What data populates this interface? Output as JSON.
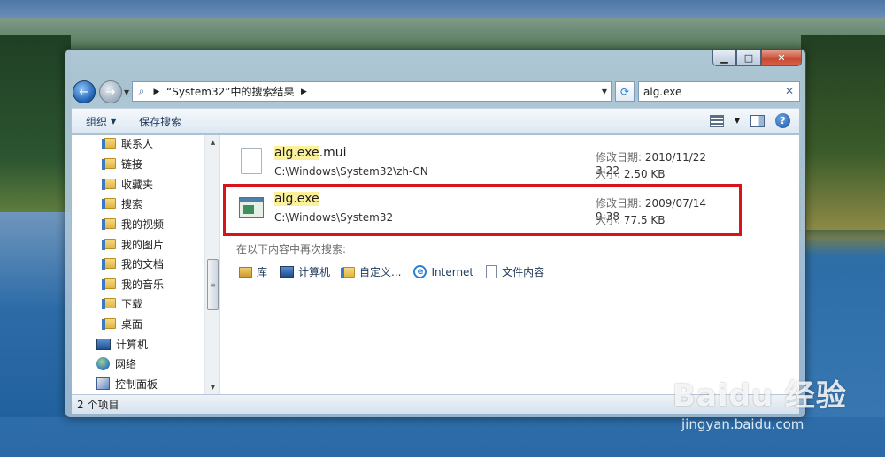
{
  "window": {
    "caption_buttons": {
      "minimize": "▁",
      "maximize": "□",
      "close": "✕"
    }
  },
  "address": {
    "breadcrumb": "“System32”中的搜索结果",
    "back_glyph": "←",
    "forward_glyph": "→"
  },
  "search": {
    "value": "alg.exe",
    "clear_glyph": "✕"
  },
  "toolbar": {
    "organize_label": "组织",
    "save_search_label": "保存搜索",
    "help_glyph": "?"
  },
  "nav_pane": {
    "items": [
      {
        "label": "联系人",
        "icon": "folder-icon"
      },
      {
        "label": "链接",
        "icon": "folder-icon"
      },
      {
        "label": "收藏夹",
        "icon": "folder-icon"
      },
      {
        "label": "搜索",
        "icon": "folder-icon"
      },
      {
        "label": "我的视频",
        "icon": "folder-icon"
      },
      {
        "label": "我的图片",
        "icon": "folder-icon"
      },
      {
        "label": "我的文档",
        "icon": "folder-icon"
      },
      {
        "label": "我的音乐",
        "icon": "folder-icon"
      },
      {
        "label": "下载",
        "icon": "folder-icon"
      },
      {
        "label": "桌面",
        "icon": "folder-icon"
      },
      {
        "label": "计算机",
        "icon": "computer-icon"
      },
      {
        "label": "网络",
        "icon": "network-icon"
      },
      {
        "label": "控制面板",
        "icon": "control-panel-icon"
      }
    ]
  },
  "results": [
    {
      "name_highlight": "alg.exe",
      "name_rest": ".mui",
      "path": "C:\\Windows\\System32\\zh-CN",
      "modified_label": "修改日期:",
      "modified_value": "2010/11/22 3:22",
      "size_label": "大小:",
      "size_value": "2.50 KB",
      "icon": "file-icon"
    },
    {
      "name_highlight": "alg.exe",
      "name_rest": "",
      "path": "C:\\Windows\\System32",
      "modified_label": "修改日期:",
      "modified_value": "2009/07/14 9:38",
      "size_label": "大小:",
      "size_value": "77.5 KB",
      "icon": "exe-icon"
    }
  ],
  "search_again": {
    "heading": "在以下内容中再次搜索:",
    "options": [
      "库",
      "计算机",
      "自定义...",
      "Internet",
      "文件内容"
    ]
  },
  "statusbar": {
    "text": "2 个项目"
  },
  "watermark": {
    "logo": "Baidu 经验",
    "url": "jingyan.baidu.com"
  },
  "colors": {
    "highlight_box": "#d8141b",
    "search_hit": "#fbf19a"
  }
}
